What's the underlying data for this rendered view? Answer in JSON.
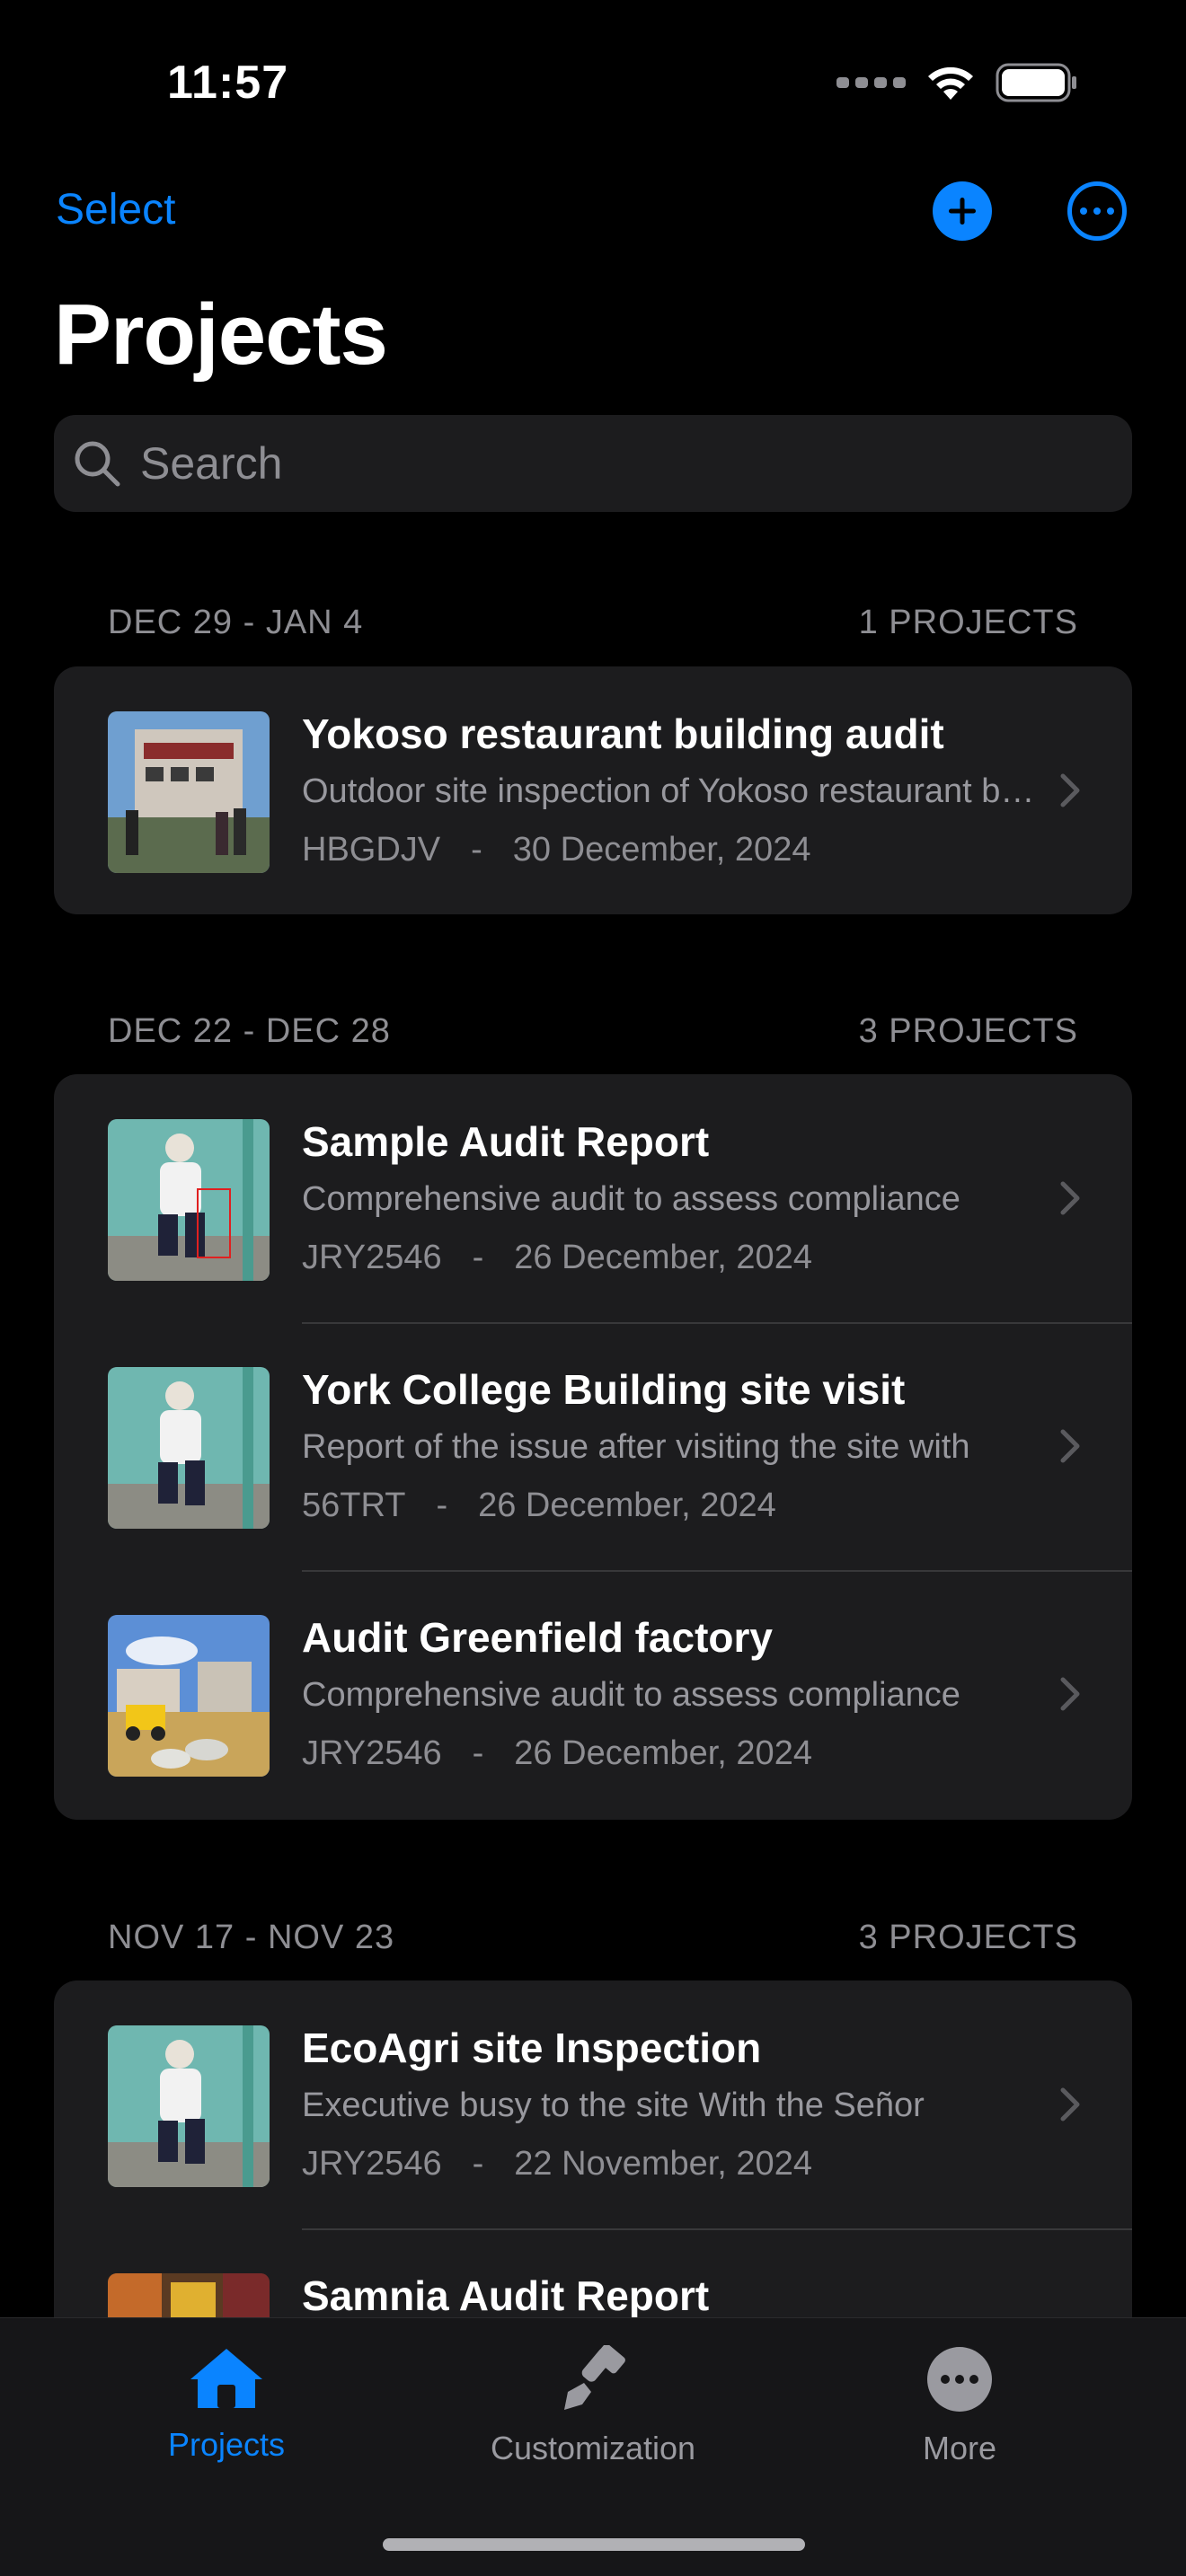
{
  "status_bar": {
    "time": "11:57"
  },
  "nav": {
    "select_label": "Select",
    "title": "Projects"
  },
  "search": {
    "placeholder": "Search"
  },
  "sections": [
    {
      "range": "DEC 29 - JAN 4",
      "count": "1 PROJECTS",
      "items": [
        {
          "title": "Yokoso restaurant building audit",
          "description": "Outdoor site inspection of Yokoso restaurant building",
          "code": "HBGDJV",
          "separator": "-",
          "date": "30 December, 2024",
          "thumb": "building"
        }
      ]
    },
    {
      "range": "DEC 22 - DEC 28",
      "count": "3 PROJECTS",
      "items": [
        {
          "title": "Sample Audit Report",
          "description": "Comprehensive audit to assess compliance",
          "code": "JRY2546",
          "separator": "-",
          "date": "26 December, 2024",
          "thumb": "worker-marked"
        },
        {
          "title": "York College Building site visit",
          "description": "Report of the issue after visiting the site with",
          "code": "56TRT",
          "separator": "-",
          "date": "26 December, 2024",
          "thumb": "worker"
        },
        {
          "title": "Audit Greenfield factory",
          "description": "Comprehensive audit to assess compliance",
          "code": "JRY2546",
          "separator": "-",
          "date": "26 December, 2024",
          "thumb": "construction"
        }
      ]
    },
    {
      "range": "NOV 17 - NOV 23",
      "count": "3 PROJECTS",
      "items": [
        {
          "title": "EcoAgri site Inspection",
          "description": "Executive busy to the site With the Señor",
          "code": "JRY2546",
          "separator": "-",
          "date": "22 November, 2024",
          "thumb": "worker"
        },
        {
          "title": "Samnia Audit Report",
          "description": "",
          "code": "",
          "separator": "",
          "date": "",
          "thumb": "market"
        }
      ]
    }
  ],
  "tabbar": {
    "tabs": [
      {
        "label": "Projects",
        "icon": "house-icon",
        "active": true
      },
      {
        "label": "Customization",
        "icon": "paintbrush-icon",
        "active": false
      },
      {
        "label": "More",
        "icon": "ellipsis-circle-icon",
        "active": false
      }
    ]
  },
  "colors": {
    "accent": "#0a84ff",
    "background": "#000000",
    "card": "#1c1c1e",
    "secondary_text": "#8e8e93"
  }
}
